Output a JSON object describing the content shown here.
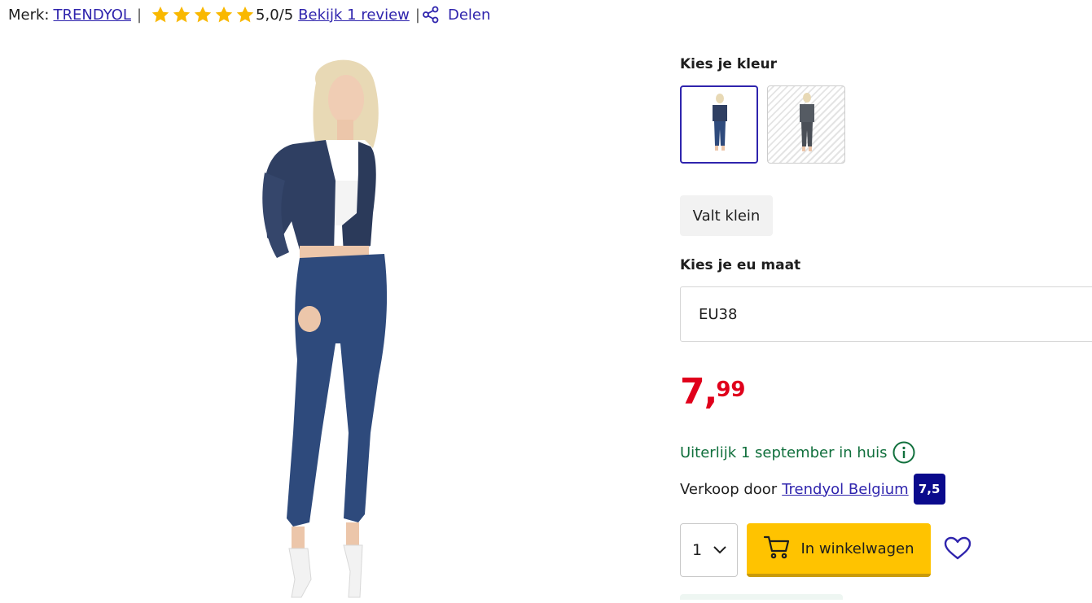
{
  "brand": {
    "label": "Merk:",
    "name": "TRENDYOL"
  },
  "rating": {
    "stars": 5,
    "max": 5,
    "display": "5,0/5",
    "review_link": "Bekijk 1 review",
    "star_color": "#f9b800"
  },
  "share": {
    "icon": "share-icon",
    "label": "Delen"
  },
  "color_picker": {
    "heading": "Kies je kleur",
    "options": [
      {
        "name": "dark-blue-denim",
        "selected": true,
        "available": true
      },
      {
        "name": "dark-grey-print",
        "selected": false,
        "available": false
      }
    ]
  },
  "fit": {
    "label": "Valt klein"
  },
  "size": {
    "heading": "Kies je eu maat",
    "selected": "EU38"
  },
  "price": {
    "euros": "7",
    "separator": ",",
    "cents": "99",
    "color": "#e0001b"
  },
  "delivery": {
    "text": "Uiterlijk 1 september in huis",
    "color": "#11703d",
    "icon": "info-icon"
  },
  "seller": {
    "label": "Verkoop door",
    "name": "Trendyol Belgium",
    "score": "7,5",
    "score_bg": "#0a0a8c"
  },
  "quantity": {
    "value": "1"
  },
  "cart_button": {
    "label": "In winkelwagen",
    "icon": "cart-icon",
    "bg": "#ffc300"
  },
  "wishlist": {
    "icon": "heart-icon"
  },
  "accent": "#2f24ad"
}
